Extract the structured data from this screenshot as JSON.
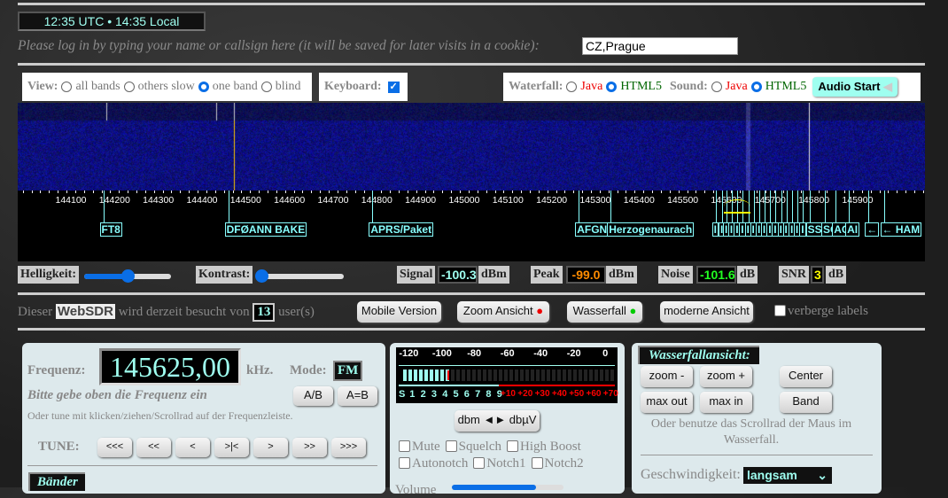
{
  "clock": "12:35 UTC • 14:35 Local",
  "login": {
    "prompt": "Please log in by typing your name or callsign here (it will be saved for later visits in a cookie):",
    "value": "CZ,Prague"
  },
  "view": {
    "label": "View:",
    "options": [
      "all bands",
      "others slow",
      "one band",
      "blind"
    ],
    "selected": "one band"
  },
  "keyboard": {
    "label": "Keyboard:",
    "checked": true
  },
  "waterfall_opt": {
    "label": "Waterfall:",
    "java": "Java",
    "html5": "HTML5",
    "selected": "HTML5"
  },
  "sound_opt": {
    "label": "Sound:",
    "java": "Java",
    "html5": "HTML5",
    "selected": "HTML5"
  },
  "audio_start": "Audio Start",
  "scale": {
    "ticks": [
      "144100",
      "144200",
      "144300",
      "144400",
      "144500",
      "144600",
      "144700",
      "144800",
      "144900",
      "145000",
      "145100",
      "145200",
      "145300",
      "145400",
      "145500",
      "145600",
      "145700",
      "145800",
      "145900"
    ],
    "tuned_khz": 145625
  },
  "labels": [
    {
      "text": "FT8",
      "khz": 144174
    },
    {
      "text": "DFØANN BAKE",
      "khz": 144460
    },
    {
      "text": "APRS/Paket",
      "khz": 144790
    },
    {
      "text": "AFGN",
      "khz": 145262
    },
    {
      "text": "Herzogenaurach",
      "khz": 145335
    },
    {
      "text": "I",
      "khz": 145575
    },
    {
      "text": "I",
      "khz": 145590
    },
    {
      "text": "I",
      "khz": 145600
    },
    {
      "text": "I",
      "khz": 145612
    },
    {
      "text": "I",
      "khz": 145625
    },
    {
      "text": "I",
      "khz": 145637
    },
    {
      "text": "I",
      "khz": 145650
    },
    {
      "text": "I",
      "khz": 145662
    },
    {
      "text": "I",
      "khz": 145675
    },
    {
      "text": "I",
      "khz": 145687
    },
    {
      "text": "I",
      "khz": 145700
    },
    {
      "text": "I",
      "khz": 145712
    },
    {
      "text": "I",
      "khz": 145725
    },
    {
      "text": "I",
      "khz": 145737
    },
    {
      "text": "I",
      "khz": 145750
    },
    {
      "text": "I",
      "khz": 145762
    },
    {
      "text": "I",
      "khz": 145775
    },
    {
      "text": "SS",
      "khz": 145790
    },
    {
      "text": "SO",
      "khz": 145825
    },
    {
      "text": "AO",
      "khz": 145850
    },
    {
      "text": "AI",
      "khz": 145880
    },
    {
      "text": "←",
      "khz": 145925
    },
    {
      "text": "← HAM",
      "khz": 145960
    }
  ],
  "controls": {
    "brightness": "Helligkeit:",
    "brightness_level": 0.5,
    "contrast": "Kontrast:",
    "contrast_level": 0.05,
    "signal": "Signal",
    "signal_val": "-100.3",
    "signal_unit": "dBm",
    "peak": "Peak",
    "peak_val": "-99.0",
    "peak_unit": "dBm",
    "noise": "Noise",
    "noise_val": "-101.6",
    "noise_unit": "dB",
    "snr": "SNR",
    "snr_val": "3",
    "snr_unit": "dB"
  },
  "visitors": {
    "pre": "Dieser",
    "logo": "WebSDR",
    "mid": "wird derzeit besucht von",
    "count": "13",
    "post": "user(s)"
  },
  "nav": {
    "mobile": "Mobile Version",
    "zoom": "Zoom Ansicht",
    "waterfall": "Wasserfall",
    "modern": "moderne Ansicht",
    "hide_labels": "verberge labels"
  },
  "colors": {
    "accent": "#9ffff0",
    "zoom_dot": "#e00000",
    "waterfall_dot": "#00c000"
  },
  "freq": {
    "label": "Frequenz:",
    "value": "145625,00",
    "unit": "kHz.",
    "mode_label": "Mode:",
    "mode": "FM",
    "hint": "Bitte gebe oben die Frequenz ein",
    "hint2": "Oder tune mit klicken/ziehen/Scrollrad auf der Frequenzleiste.",
    "ab": "A/B",
    "aeqb": "A=B",
    "tune": "TUNE:",
    "tune_buttons": [
      "<<<",
      "<<",
      "<",
      ">|<",
      ">",
      ">>",
      ">>>"
    ],
    "bands": "Bänder"
  },
  "smeter": {
    "dbm_ticks": [
      "-120",
      "-100",
      "-80",
      "-60",
      "-40",
      "-20",
      "0"
    ],
    "s_ticks": [
      "S",
      "1",
      "2",
      "3",
      "4",
      "5",
      "6",
      "7",
      "8",
      "9"
    ],
    "plus_ticks": [
      "+10",
      "+20",
      "+30",
      "+40",
      "+50",
      "+60",
      "+70"
    ],
    "level_dbm": -100.3,
    "toggle": "dbm ◄► dbµV",
    "checks": [
      "Mute",
      "Squelch",
      "High Boost",
      "Autonotch",
      "Notch1",
      "Notch2"
    ],
    "volume": "Volume"
  },
  "wfview": {
    "title": "Wasserfallansicht:",
    "zoom_minus": "zoom  -",
    "zoom_plus": "zoom +",
    "center": "Center",
    "max_out": "max out",
    "max_in": "max in",
    "band": "Band",
    "hint": "Oder benutze das Scrollrad der Maus im Wasserfall.",
    "speed_label": "Geschwindigkeit:",
    "speed": "langsam"
  }
}
